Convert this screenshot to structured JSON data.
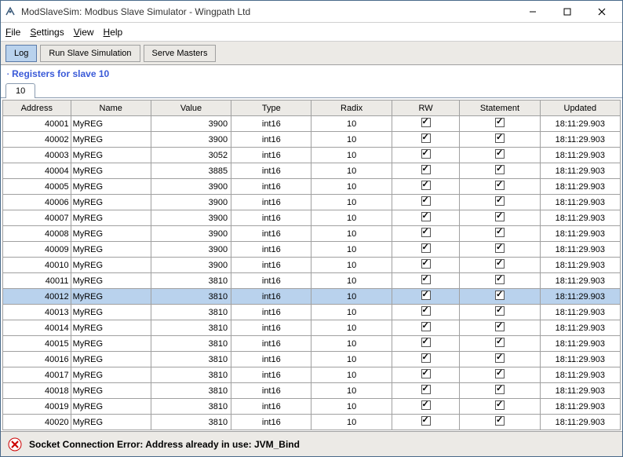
{
  "window": {
    "title": "ModSlaveSim:  Modbus Slave Simulator - Wingpath Ltd"
  },
  "menu": {
    "file": "File",
    "settings": "Settings",
    "view": "View",
    "help": "Help"
  },
  "toolbar": {
    "log": "Log",
    "run_sim": "Run Slave Simulation",
    "serve_masters": "Serve Masters"
  },
  "panel": {
    "title": "Registers for slave 10",
    "tab": "10"
  },
  "table": {
    "headers": {
      "address": "Address",
      "name": "Name",
      "value": "Value",
      "type": "Type",
      "radix": "Radix",
      "rw": "RW",
      "statement": "Statement",
      "updated": "Updated"
    },
    "rows": [
      {
        "address": "40001",
        "name": "MyREG",
        "value": "3900",
        "type": "int16",
        "radix": "10",
        "rw": true,
        "statement": true,
        "updated": "18:11:29.903",
        "selected": false
      },
      {
        "address": "40002",
        "name": "MyREG",
        "value": "3900",
        "type": "int16",
        "radix": "10",
        "rw": true,
        "statement": true,
        "updated": "18:11:29.903",
        "selected": false
      },
      {
        "address": "40003",
        "name": "MyREG",
        "value": "3052",
        "type": "int16",
        "radix": "10",
        "rw": true,
        "statement": true,
        "updated": "18:11:29.903",
        "selected": false
      },
      {
        "address": "40004",
        "name": "MyREG",
        "value": "3885",
        "type": "int16",
        "radix": "10",
        "rw": true,
        "statement": true,
        "updated": "18:11:29.903",
        "selected": false
      },
      {
        "address": "40005",
        "name": "MyREG",
        "value": "3900",
        "type": "int16",
        "radix": "10",
        "rw": true,
        "statement": true,
        "updated": "18:11:29.903",
        "selected": false
      },
      {
        "address": "40006",
        "name": "MyREG",
        "value": "3900",
        "type": "int16",
        "radix": "10",
        "rw": true,
        "statement": true,
        "updated": "18:11:29.903",
        "selected": false
      },
      {
        "address": "40007",
        "name": "MyREG",
        "value": "3900",
        "type": "int16",
        "radix": "10",
        "rw": true,
        "statement": true,
        "updated": "18:11:29.903",
        "selected": false
      },
      {
        "address": "40008",
        "name": "MyREG",
        "value": "3900",
        "type": "int16",
        "radix": "10",
        "rw": true,
        "statement": true,
        "updated": "18:11:29.903",
        "selected": false
      },
      {
        "address": "40009",
        "name": "MyREG",
        "value": "3900",
        "type": "int16",
        "radix": "10",
        "rw": true,
        "statement": true,
        "updated": "18:11:29.903",
        "selected": false
      },
      {
        "address": "40010",
        "name": "MyREG",
        "value": "3900",
        "type": "int16",
        "radix": "10",
        "rw": true,
        "statement": true,
        "updated": "18:11:29.903",
        "selected": false
      },
      {
        "address": "40011",
        "name": "MyREG",
        "value": "3810",
        "type": "int16",
        "radix": "10",
        "rw": true,
        "statement": true,
        "updated": "18:11:29.903",
        "selected": false
      },
      {
        "address": "40012",
        "name": "MyREG",
        "value": "3810",
        "type": "int16",
        "radix": "10",
        "rw": true,
        "statement": true,
        "updated": "18:11:29.903",
        "selected": true
      },
      {
        "address": "40013",
        "name": "MyREG",
        "value": "3810",
        "type": "int16",
        "radix": "10",
        "rw": true,
        "statement": true,
        "updated": "18:11:29.903",
        "selected": false
      },
      {
        "address": "40014",
        "name": "MyREG",
        "value": "3810",
        "type": "int16",
        "radix": "10",
        "rw": true,
        "statement": true,
        "updated": "18:11:29.903",
        "selected": false
      },
      {
        "address": "40015",
        "name": "MyREG",
        "value": "3810",
        "type": "int16",
        "radix": "10",
        "rw": true,
        "statement": true,
        "updated": "18:11:29.903",
        "selected": false
      },
      {
        "address": "40016",
        "name": "MyREG",
        "value": "3810",
        "type": "int16",
        "radix": "10",
        "rw": true,
        "statement": true,
        "updated": "18:11:29.903",
        "selected": false
      },
      {
        "address": "40017",
        "name": "MyREG",
        "value": "3810",
        "type": "int16",
        "radix": "10",
        "rw": true,
        "statement": true,
        "updated": "18:11:29.903",
        "selected": false
      },
      {
        "address": "40018",
        "name": "MyREG",
        "value": "3810",
        "type": "int16",
        "radix": "10",
        "rw": true,
        "statement": true,
        "updated": "18:11:29.903",
        "selected": false
      },
      {
        "address": "40019",
        "name": "MyREG",
        "value": "3810",
        "type": "int16",
        "radix": "10",
        "rw": true,
        "statement": true,
        "updated": "18:11:29.903",
        "selected": false
      },
      {
        "address": "40020",
        "name": "MyREG",
        "value": "3810",
        "type": "int16",
        "radix": "10",
        "rw": true,
        "statement": true,
        "updated": "18:11:29.903",
        "selected": false
      }
    ]
  },
  "status": {
    "error": "Socket Connection Error: Address already in use: JVM_Bind"
  }
}
